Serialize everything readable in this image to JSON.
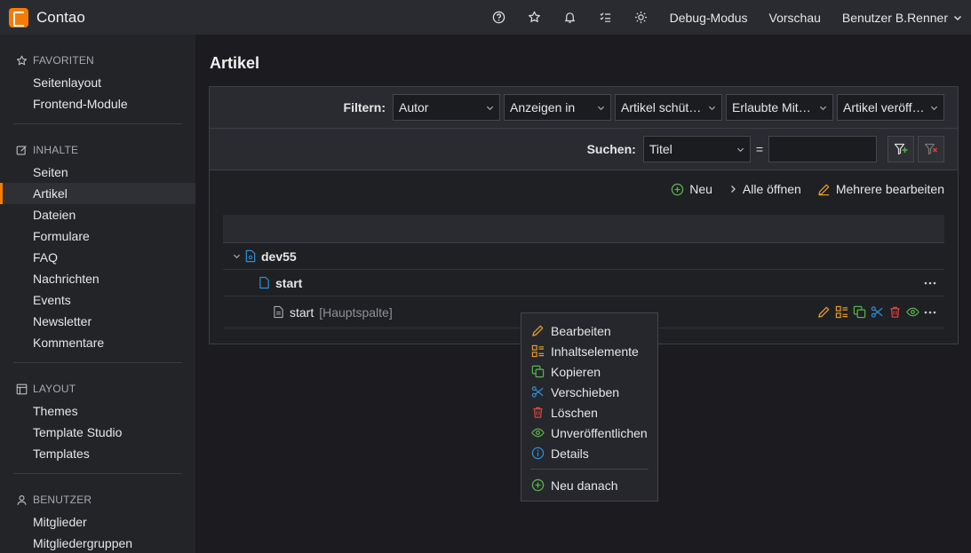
{
  "header": {
    "app_name": "Contao",
    "debug_label": "Debug-Modus",
    "preview_label": "Vorschau",
    "user_label": "Benutzer B.Renner"
  },
  "sidebar": {
    "groups": [
      {
        "title": "FAVORITEN",
        "icon": "star-icon",
        "items": [
          "Seitenlayout",
          "Frontend-Module"
        ]
      },
      {
        "title": "INHALTE",
        "icon": "edit-icon",
        "items": [
          "Seiten",
          "Artikel",
          "Dateien",
          "Formulare",
          "FAQ",
          "Nachrichten",
          "Events",
          "Newsletter",
          "Kommentare"
        ]
      },
      {
        "title": "LAYOUT",
        "icon": "layout-icon",
        "items": [
          "Themes",
          "Template Studio",
          "Templates"
        ]
      },
      {
        "title": "BENUTZER",
        "icon": "user-icon",
        "items": [
          "Mitglieder",
          "Mitgliedergruppen"
        ]
      }
    ],
    "active_item": "Artikel"
  },
  "main": {
    "title": "Artikel",
    "filter_label": "Filtern:",
    "filters": [
      "Autor",
      "Anzeigen in",
      "Artikel schüt…",
      "Erlaubte Mit…",
      "Artikel veröff…"
    ],
    "search_label": "Suchen:",
    "search_field": "Titel",
    "search_eq": "=",
    "search_value": "",
    "ops": {
      "new": "Neu",
      "open_all": "Alle öffnen",
      "edit_multiple": "Mehrere bearbeiten"
    },
    "tree": {
      "root": "dev55",
      "page": "start",
      "article": "start",
      "article_column": "[Hauptspalte]"
    }
  },
  "context_menu": {
    "items": [
      "Bearbeiten",
      "Inhaltselemente",
      "Kopieren",
      "Verschieben",
      "Löschen",
      "Unveröffentlichen",
      "Details"
    ],
    "after": "Neu danach"
  },
  "colors": {
    "accent": "#f47c00",
    "edit": "#e49b2c",
    "copy": "#58b34b",
    "move": "#2f8ed6",
    "delete": "#d9453e",
    "publish": "#58b34b",
    "info": "#2f8ed6"
  }
}
